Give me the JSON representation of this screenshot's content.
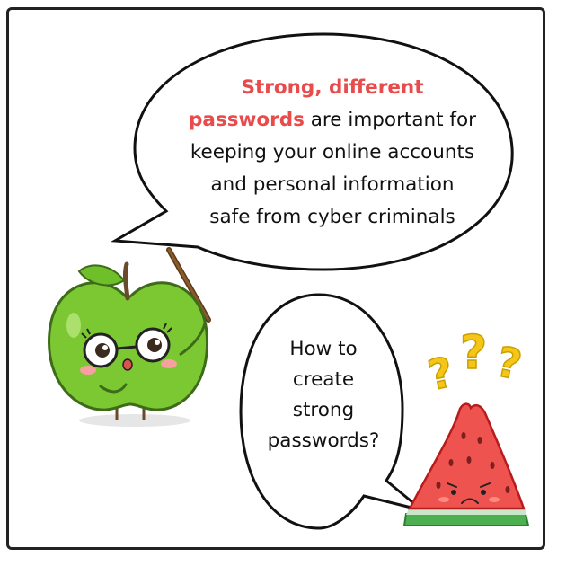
{
  "big_bubble": {
    "highlight_line1": "Strong, different",
    "highlight_line2": "passwords",
    "text_line2_rest": " are important for",
    "text_line3": "keeping your online accounts",
    "text_line4": "and personal information",
    "text_line5": "safe from cyber criminals"
  },
  "small_bubble": {
    "line1": "How to",
    "line2": "create",
    "line3": "strong",
    "line4": "passwords?"
  },
  "colors": {
    "highlight": "#e84b4b",
    "apple": "#7cc832",
    "watermelon_flesh": "#ef5350",
    "question_marks": "#f5c518"
  },
  "icons": {
    "apple_character": "apple-with-glasses-icon",
    "pointer_stick": "pointer-stick-icon",
    "watermelon_character": "watermelon-slice-icon",
    "question_marks": "question-marks-icon"
  }
}
